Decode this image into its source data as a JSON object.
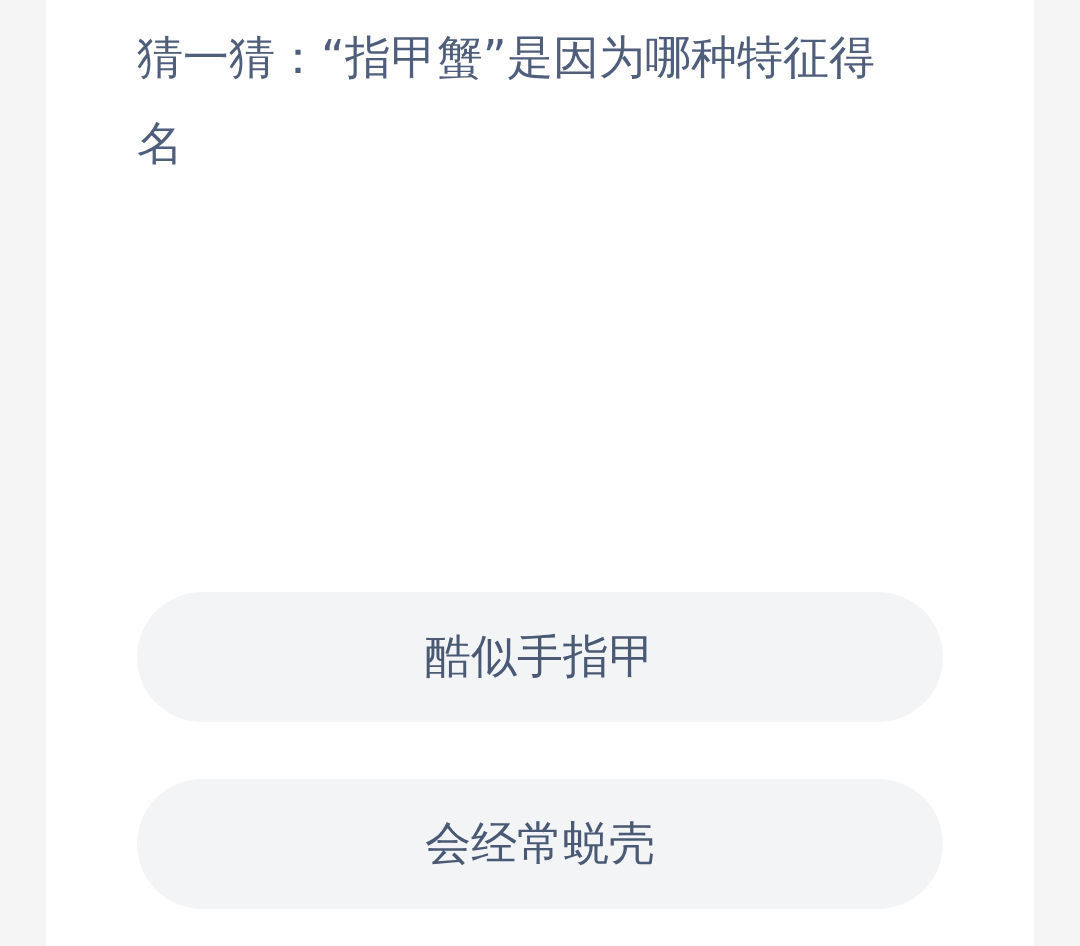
{
  "question": {
    "text": "猜一猜：“指甲蟹”是因为哪种特征得名"
  },
  "options": [
    {
      "label": "酷似手指甲"
    },
    {
      "label": "会经常蜕壳"
    }
  ]
}
